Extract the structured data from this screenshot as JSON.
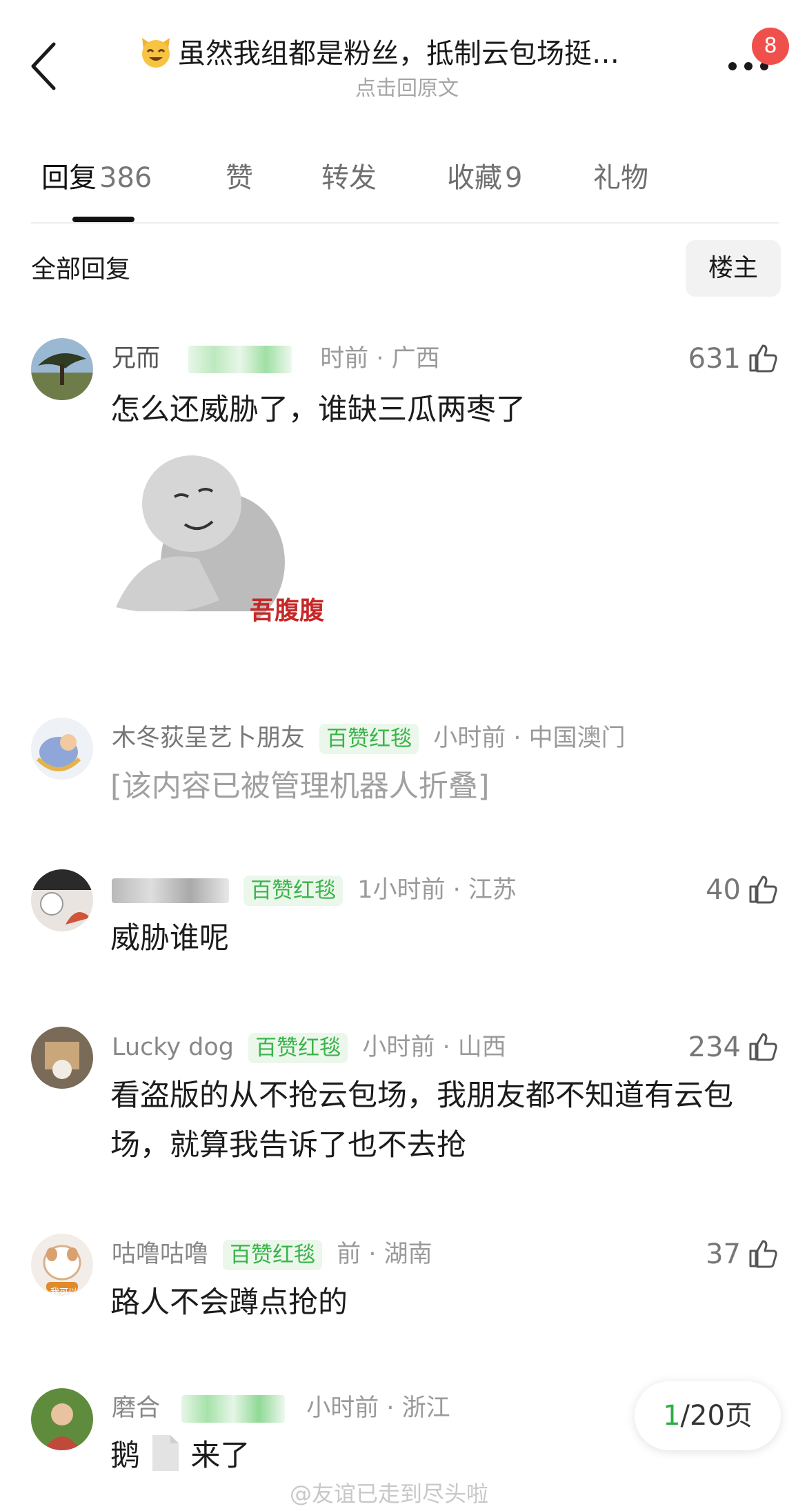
{
  "header": {
    "title": "虽然我组都是粉丝，抵制云包场挺…",
    "subtitle": "点击回原文",
    "notification_count": "8"
  },
  "tabs": [
    {
      "label": "回复",
      "count": "386"
    },
    {
      "label": "赞",
      "count": ""
    },
    {
      "label": "转发",
      "count": ""
    },
    {
      "label": "收藏",
      "count": "9"
    },
    {
      "label": "礼物",
      "count": ""
    }
  ],
  "filter": {
    "all_label": "全部回复",
    "op_button": "楼主"
  },
  "comments": [
    {
      "user": "兄而",
      "time": "时前 · 广西",
      "text": "怎么还威胁了，谁缺三瓜两枣了",
      "likes": "631",
      "sticker_caption": "吾腹腹"
    },
    {
      "user": "木冬荻呈艺卜朋友",
      "tag": "百赞红毯",
      "time": "小时前 · 中国澳门",
      "text": "[该内容已被管理机器人折叠]"
    },
    {
      "user": "",
      "tag": "百赞红毯",
      "time": "1小时前 · 江苏",
      "text": "威胁谁呢",
      "likes": "40"
    },
    {
      "user": "Lucky dog",
      "tag": "百赞红毯",
      "time": "小时前 · 山西",
      "text": "看盗版的从不抢云包场，我朋友都不知道有云包场，就算我告诉了也不去抢",
      "likes": "234",
      "avatar_caption": ""
    },
    {
      "user": "咕噜咕噜",
      "tag": "百赞红毯",
      "time": "前 · 湖南",
      "text": "路人不会蹲点抢的",
      "likes": "37",
      "avatar_caption": "我可以"
    },
    {
      "user": "磨合",
      "time": "小时前 · 浙江",
      "text_before": "鹅",
      "text_after": "来了"
    }
  ],
  "pager": {
    "current": "1",
    "total": "/20",
    "unit": "页"
  },
  "watermark": "@友谊已走到尽头啦",
  "colors": {
    "accent_green": "#3bb34a",
    "badge_red": "#f0504c",
    "sticker_red": "#c62828"
  }
}
